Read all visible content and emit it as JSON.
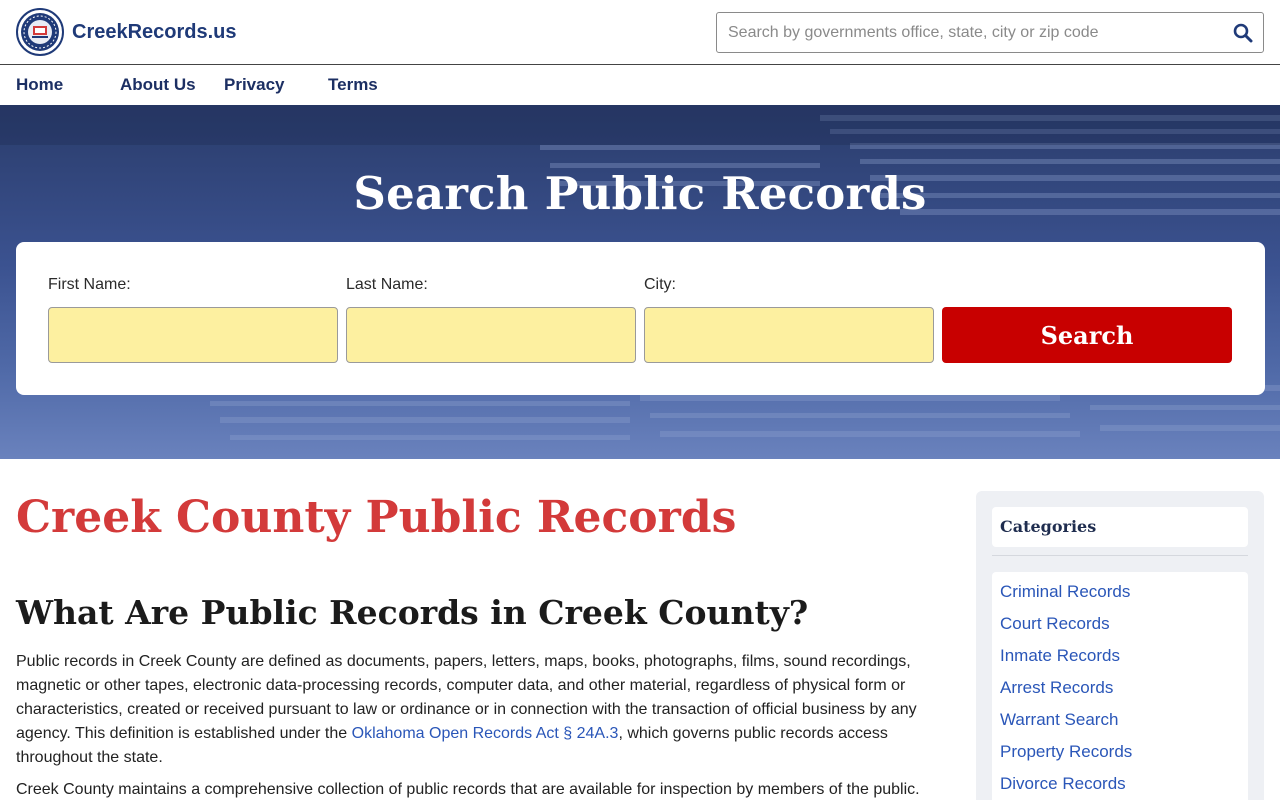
{
  "site": {
    "name": "CreekRecords.us"
  },
  "header_search": {
    "placeholder": "Search by governments office, state, city or zip code"
  },
  "nav": {
    "items": [
      {
        "label": "Home"
      },
      {
        "label": "About Us"
      },
      {
        "label": "Privacy"
      },
      {
        "label": "Terms"
      }
    ]
  },
  "hero": {
    "title": "Search Public Records",
    "form": {
      "first_name_label": "First Name:",
      "last_name_label": "Last Name:",
      "city_label": "City:",
      "first_name_value": "",
      "last_name_value": "",
      "city_value": "",
      "search_button": "Search"
    }
  },
  "main": {
    "title": "Creek County Public Records",
    "heading": "What Are Public Records in Creek County?",
    "para1_before": "Public records in Creek County are defined as documents, papers, letters, maps, books, photographs, films, sound recordings, magnetic or other tapes, electronic data-processing records, computer data, and other material, regardless of physical form or characteristics, created or received pursuant to law or ordinance or in connection with the transaction of official business by any agency. This definition is established under the ",
    "para1_link": "Oklahoma Open Records Act § 24A.3",
    "para1_after": ", which governs public records access throughout the state.",
    "para2": "Creek County maintains a comprehensive collection of public records that are available for inspection by members of the public."
  },
  "sidebar": {
    "heading": "Categories",
    "items": [
      {
        "label": "Criminal Records"
      },
      {
        "label": "Court Records"
      },
      {
        "label": "Inmate Records"
      },
      {
        "label": "Arrest Records"
      },
      {
        "label": "Warrant Search"
      },
      {
        "label": "Property Records"
      },
      {
        "label": "Divorce Records"
      }
    ]
  },
  "colors": {
    "brand_blue": "#1f3a78",
    "title_red": "#d33a3a",
    "button_red": "#c80000",
    "input_yellow": "#fdf0a0",
    "link_blue": "#2a56b8"
  },
  "icons": {
    "logo": "seal-icon",
    "search": "magnifier-icon"
  }
}
